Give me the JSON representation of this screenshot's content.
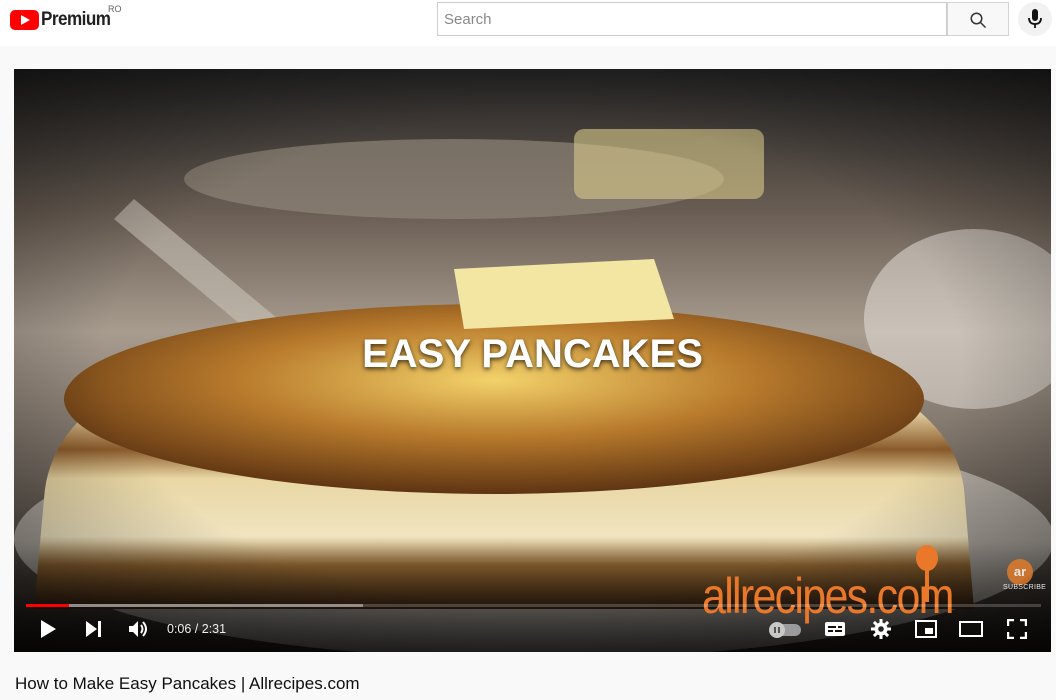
{
  "masthead": {
    "logo_text": "Premium",
    "country_code": "RO",
    "search_placeholder": "Search",
    "search_icon": "search-icon",
    "mic_icon": "microphone-icon"
  },
  "video": {
    "overlay_title": "EASY PANCAKES",
    "brand_watermark": "allrecipes.com",
    "subscribe_badge": "ar",
    "subscribe_label": "SUBSCRIBE",
    "current_time": "0:06",
    "duration": "2:31",
    "time_display": "0:06 / 2:31",
    "progress_played_fraction": 0.042,
    "progress_buffered_fraction": 0.332
  },
  "controls": {
    "play": "play-icon",
    "next": "next-icon",
    "volume": "volume-icon",
    "autoplay": "autoplay-toggle",
    "subtitles": "subtitles-icon",
    "settings": "gear-icon",
    "miniplayer": "miniplayer-icon",
    "theater": "theater-mode-icon",
    "fullscreen": "fullscreen-icon"
  },
  "colors": {
    "brand_red": "#ff0000",
    "allrecipes_orange": "#e9782a"
  },
  "caption": "How to Make Easy Pancakes | Allrecipes.com"
}
